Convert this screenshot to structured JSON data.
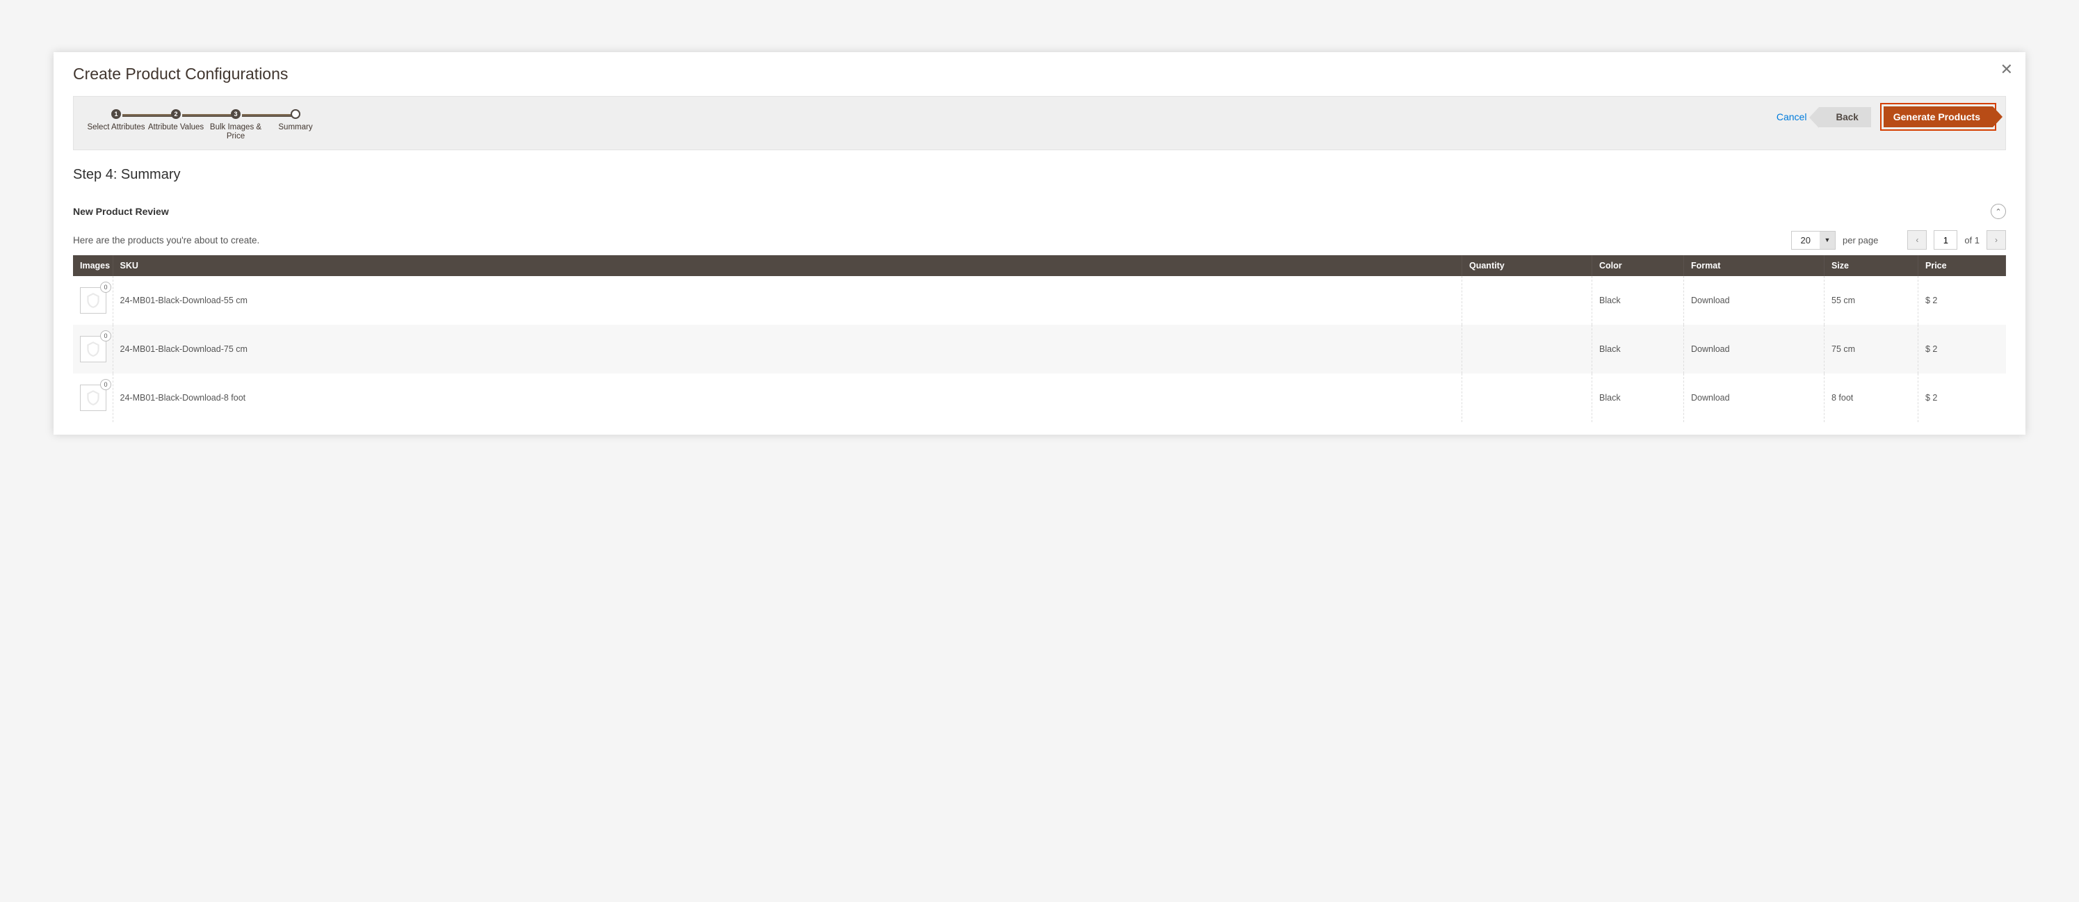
{
  "modal": {
    "title": "Create Product Configurations"
  },
  "stepper": {
    "steps": [
      {
        "num": "1",
        "label": "Select Attributes"
      },
      {
        "num": "2",
        "label": "Attribute Values"
      },
      {
        "num": "3",
        "label": "Bulk Images & Price"
      },
      {
        "num": "",
        "label": "Summary"
      }
    ]
  },
  "actions": {
    "cancel": "Cancel",
    "back": "Back",
    "generate": "Generate Products"
  },
  "heading": "Step 4: Summary",
  "section": {
    "title": "New Product Review",
    "subtext": "Here are the products you're about to create."
  },
  "pager": {
    "per_page_value": "20",
    "per_page_label": "per page",
    "page_value": "1",
    "of_label": "of 1"
  },
  "table": {
    "headers": [
      "Images",
      "SKU",
      "Quantity",
      "Color",
      "Format",
      "Size",
      "Price"
    ],
    "rows": [
      {
        "badge": "0",
        "sku": "24-MB01-Black-Download-55 cm",
        "quantity": "",
        "color": "Black",
        "format": "Download",
        "size": "55 cm",
        "price": "$ 2"
      },
      {
        "badge": "0",
        "sku": "24-MB01-Black-Download-75 cm",
        "quantity": "",
        "color": "Black",
        "format": "Download",
        "size": "75 cm",
        "price": "$ 2"
      },
      {
        "badge": "0",
        "sku": "24-MB01-Black-Download-8 foot",
        "quantity": "",
        "color": "Black",
        "format": "Download",
        "size": "8 foot",
        "price": "$ 2"
      }
    ]
  }
}
